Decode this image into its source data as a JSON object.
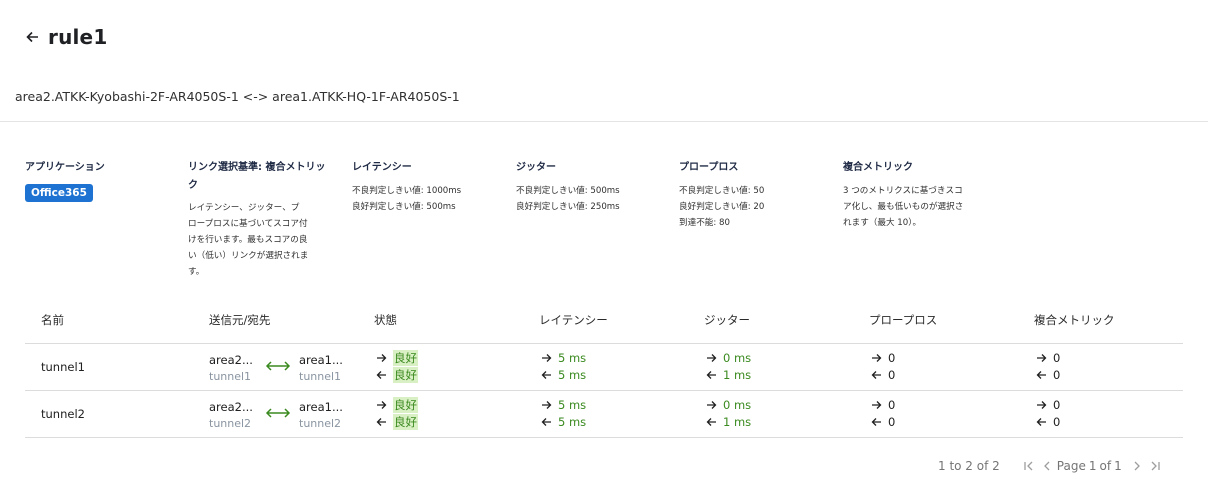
{
  "header": {
    "title": "rule1"
  },
  "path": "area2.ATKK-Kyobashi-2F-AR4050S-1 <-> area1.ATKK-HQ-1F-AR4050S-1",
  "info": {
    "application": {
      "title": "アプリケーション",
      "badge": "Office365"
    },
    "link_selection": {
      "title_line1": "リンク選択基準: 複合メトリッ",
      "title_line2": "ク",
      "desc": [
        "レイテンシー、ジッター、プ",
        "ロープロスに基づいてスコア付",
        "けを行います。最もスコアの良",
        "い（低い）リンクが選択されま",
        "す。"
      ]
    },
    "latency": {
      "title": "レイテンシー",
      "lines": [
        "不良判定しきい値: 1000ms",
        "良好判定しきい値: 500ms"
      ]
    },
    "jitter": {
      "title": "ジッター",
      "lines": [
        "不良判定しきい値: 500ms",
        "良好判定しきい値: 250ms"
      ]
    },
    "probe_loss": {
      "title": "プロープロス",
      "lines": [
        "不良判定しきい値: 50",
        "良好判定しきい値: 20",
        "到達不能: 80"
      ]
    },
    "composite": {
      "title": "複合メトリック",
      "lines": [
        "3 つのメトリクスに基づきスコ",
        "ア化し、最も低いものが選択さ",
        "れます（最大 10）。"
      ]
    }
  },
  "table": {
    "headers": [
      "名前",
      "送信元/宛先",
      "状態",
      "レイテンシー",
      "ジッター",
      "プロープロス",
      "複合メトリック"
    ],
    "rows": [
      {
        "name": "tunnel1",
        "src": "area2...",
        "src_sub": "tunnel1",
        "dst": "area1...",
        "dst_sub": "tunnel1",
        "state_out": "良好",
        "state_in": "良好",
        "latency_out": "5 ms",
        "latency_in": "5 ms",
        "jitter_out": "0 ms",
        "jitter_in": "1 ms",
        "loss_out": "0",
        "loss_in": "0",
        "composite_out": "0",
        "composite_in": "0"
      },
      {
        "name": "tunnel2",
        "src": "area2...",
        "src_sub": "tunnel2",
        "dst": "area1...",
        "dst_sub": "tunnel2",
        "state_out": "良好",
        "state_in": "良好",
        "latency_out": "5 ms",
        "latency_in": "5 ms",
        "jitter_out": "0 ms",
        "jitter_in": "1 ms",
        "loss_out": "0",
        "loss_in": "0",
        "composite_out": "0",
        "composite_in": "0"
      }
    ]
  },
  "pager": {
    "range": "1 to 2 of 2",
    "page_label": "Page",
    "page": "1",
    "of": "of",
    "total": "1"
  },
  "colors": {
    "accent": "#1e73d2",
    "good": "#3a8a1f",
    "good_bg": "#d9efc4"
  }
}
